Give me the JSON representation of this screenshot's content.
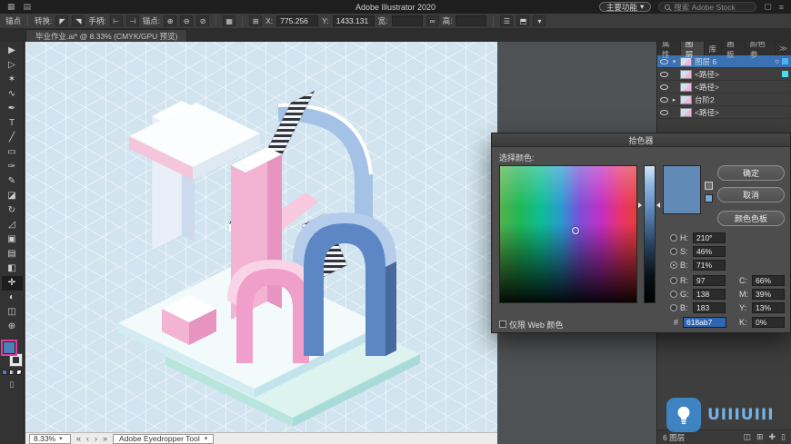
{
  "menubar": {
    "title": "Adobe Illustrator 2020",
    "left_icons": [
      {
        "name": "app-grid-icon",
        "glyph": "▦"
      },
      {
        "name": "home-icon",
        "glyph": "▤"
      }
    ],
    "feature_button": "主要功能",
    "feature_caret": "▾",
    "search_placeholder": "搜索 Adobe Stock",
    "right_icons": [
      {
        "name": "arrange-documents-icon",
        "glyph": "▢"
      },
      {
        "name": "workspace-switcher-icon",
        "glyph": "≡"
      }
    ]
  },
  "controlbar": {
    "anchor_label": "锚点",
    "convert_label": "转换:",
    "handles_label": "手柄:",
    "anchors_label": "锚点:",
    "x_label": "X:",
    "x_value": "775.256",
    "y_label": "Y:",
    "y_value": "1433.131",
    "w_label": "宽:",
    "w_value": "",
    "h_label": "高:",
    "h_value": "",
    "icons": {
      "convert": [
        "◤",
        "◥"
      ],
      "handles": [
        "⊢",
        "⊣"
      ],
      "anchors": [
        "⊕",
        "⊖",
        "⊘"
      ],
      "grid": "▦",
      "reference": "⊞",
      "link": "∞",
      "more": [
        "☰",
        "⬒",
        "▾"
      ]
    }
  },
  "tabbar": {
    "document_tab": "毕业作业.ai* @ 8.33% (CMYK/GPU 预览)"
  },
  "toolbar": {
    "fill_color": "#4f81b8",
    "tools": [
      {
        "name": "selection-tool",
        "glyph": "▶"
      },
      {
        "name": "direct-selection-tool",
        "glyph": "▷"
      },
      {
        "name": "magic-wand-tool",
        "glyph": "✶"
      },
      {
        "name": "lasso-tool",
        "glyph": "∿"
      },
      {
        "name": "pen-tool",
        "glyph": "✒"
      },
      {
        "name": "type-tool",
        "glyph": "T"
      },
      {
        "name": "line-tool",
        "glyph": "╱"
      },
      {
        "name": "rectangle-tool",
        "glyph": "▭"
      },
      {
        "name": "paintbrush-tool",
        "glyph": "✑"
      },
      {
        "name": "pencil-tool",
        "glyph": "✎"
      },
      {
        "name": "eraser-tool",
        "glyph": "◪"
      },
      {
        "name": "rotate-tool",
        "glyph": "↻"
      },
      {
        "name": "scale-tool",
        "glyph": "◿"
      },
      {
        "name": "free-transform-tool",
        "glyph": "▣"
      },
      {
        "name": "mesh-tool",
        "glyph": "▤"
      },
      {
        "name": "gradient-tool",
        "glyph": "◧"
      },
      {
        "name": "eyedropper-tool",
        "glyph": "✛",
        "active": true
      },
      {
        "name": "blend-tool",
        "glyph": "◐"
      },
      {
        "name": "artboard-tool",
        "glyph": "◫"
      },
      {
        "name": "zoom-tool",
        "glyph": "⊕"
      }
    ]
  },
  "dialog": {
    "title": "拾色器",
    "select_label": "选择颜色:",
    "preview_color": "#618ab7",
    "buttons": {
      "ok": "确定",
      "cancel": "取消",
      "swatches": "颜色色板"
    },
    "hsb": {
      "h_label": "H:",
      "h": "210°",
      "s_label": "S:",
      "s": "46%",
      "b_label": "B:",
      "b": "71%"
    },
    "rgb": {
      "r_label": "R:",
      "r": "97",
      "g_label": "G:",
      "g": "138",
      "b_label": "B:",
      "b": "183"
    },
    "hex_label": "#",
    "hex": "618ab7",
    "cmyk": {
      "c_label": "C:",
      "c": "66%",
      "m_label": "M:",
      "m": "39%",
      "y_label": "Y:",
      "y": "13%",
      "k_label": "K:",
      "k": "0%"
    },
    "web_only_label": "仅限 Web 颜色"
  },
  "panels": {
    "tabs": [
      "属性",
      "图层",
      "库",
      "画板",
      "颜色参"
    ],
    "more_glyph": "≫",
    "target_glyph": "○",
    "layers": [
      {
        "label": "图层 6",
        "arrow": "▾"
      },
      {
        "label": "<路径>",
        "arrow": ""
      },
      {
        "label": "<路径>",
        "arrow": ""
      },
      {
        "label": "台阶2",
        "arrow": "▸"
      },
      {
        "label": "<路径>",
        "arrow": ""
      }
    ],
    "footer": {
      "count": "6 图层",
      "icons": [
        "◫",
        "⊞",
        "✚",
        "▯"
      ]
    }
  },
  "statusbar": {
    "zoom": "8.33%",
    "caret": "▾",
    "nav_first": "«",
    "nav_prev": "‹",
    "nav_next": "›",
    "nav_last": "»",
    "tool_name": "Adobe Eyedropper Tool"
  },
  "watermark": {
    "text": "UIIIUIII"
  }
}
